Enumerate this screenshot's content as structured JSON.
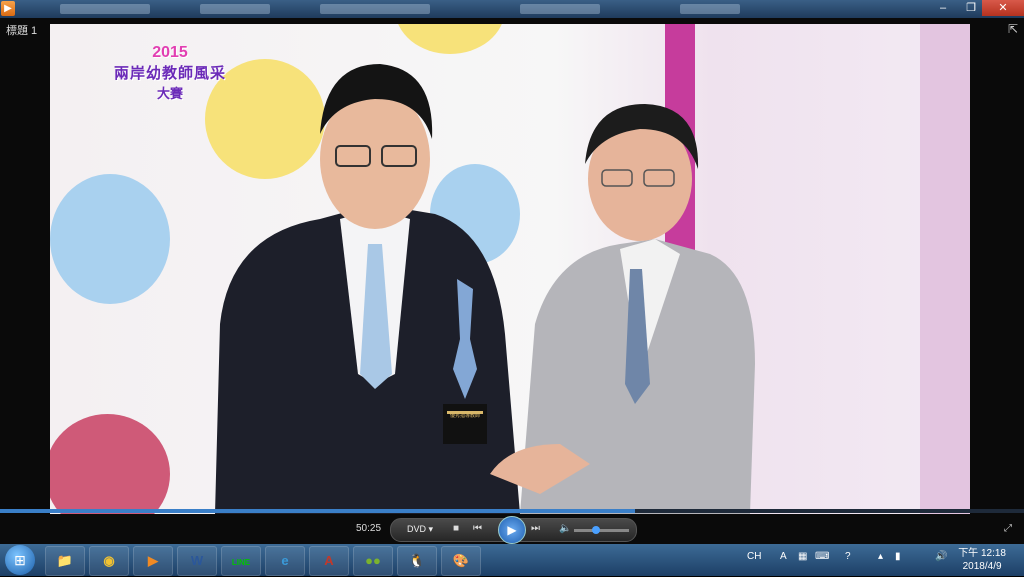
{
  "window": {
    "doc_title": "標題 1",
    "minimize_icon": "minimize-icon",
    "restore_icon": "restore-icon",
    "close_icon": "close-icon"
  },
  "video": {
    "logo_year": "2015",
    "logo_line1": "兩岸幼教師風采",
    "logo_line2": "大賽",
    "trophy_plaque_text": "優秀指導教師"
  },
  "player": {
    "time": "50:25",
    "source": "DVD",
    "progress_fraction": 0.62,
    "volume_fraction": 0.4,
    "buttons": [
      "stop",
      "previous",
      "play",
      "next",
      "mute"
    ]
  },
  "taskbar": {
    "apps": [
      {
        "name": "explorer",
        "glyph": "📁",
        "color": "#e8c25a"
      },
      {
        "name": "chrome",
        "glyph": "◉",
        "color": "#f1c232"
      },
      {
        "name": "media-player",
        "glyph": "▶",
        "color": "#f08a24"
      },
      {
        "name": "word",
        "glyph": "W",
        "color": "#2b579a"
      },
      {
        "name": "line",
        "glyph": "LINE",
        "color": "#00c300"
      },
      {
        "name": "ie",
        "glyph": "e",
        "color": "#3a9ad9"
      },
      {
        "name": "acrobat",
        "glyph": "A",
        "color": "#c0392b"
      },
      {
        "name": "wechat",
        "glyph": "●●",
        "color": "#7bb32e"
      },
      {
        "name": "qq",
        "glyph": "🐧",
        "color": "#222"
      },
      {
        "name": "paint",
        "glyph": "🎨",
        "color": "#c8a060"
      }
    ],
    "tray_text": "CH",
    "clock_ampm_time": "下午 12:18",
    "clock_date": "2018/4/9"
  }
}
